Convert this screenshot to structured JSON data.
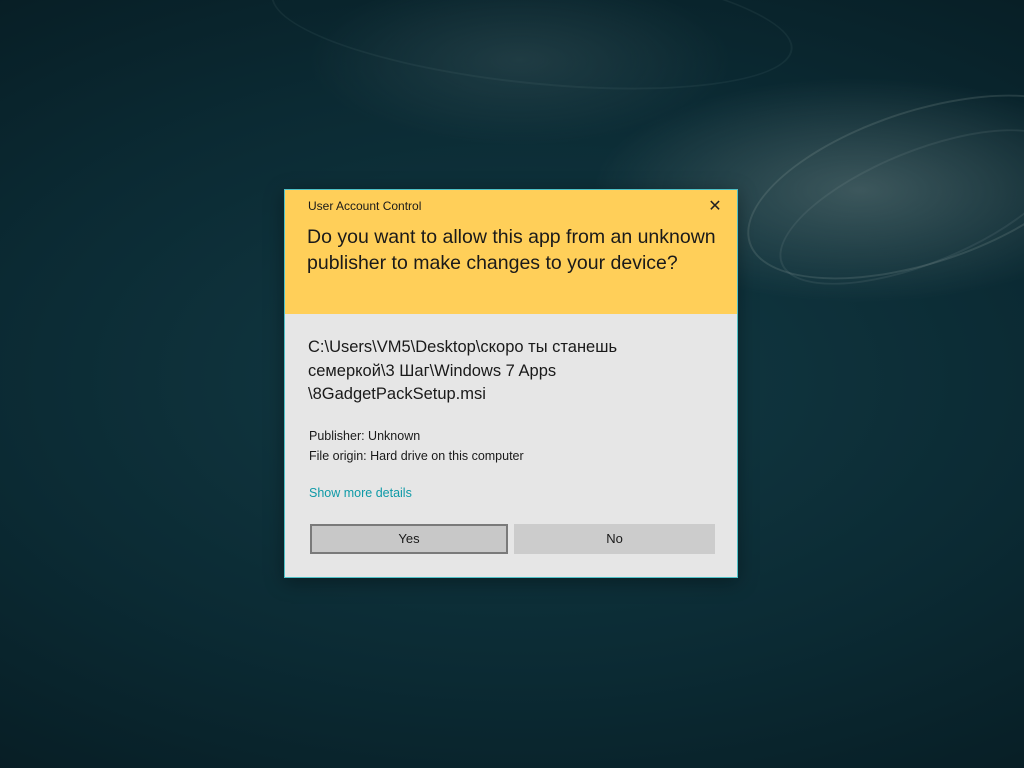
{
  "dialog": {
    "title": "User Account Control",
    "close_glyph": "✕",
    "question": "Do you want to allow this app from an unknown publisher to make changes to your device?",
    "path_lines": [
      "C:\\Users\\VM5\\Desktop\\скоро ты станешь",
      "семеркой\\3 Шаг\\Windows 7 Apps",
      "\\8GadgetPackSetup.msi"
    ],
    "publisher": "Publisher: Unknown",
    "file_origin": "File origin: Hard drive on this computer",
    "show_more": "Show more details",
    "yes_label": "Yes",
    "no_label": "No"
  },
  "colors": {
    "header": "#ffcf59",
    "body": "#e6e6e6",
    "link": "#0e9aa7",
    "border": "#4fc1c7"
  }
}
